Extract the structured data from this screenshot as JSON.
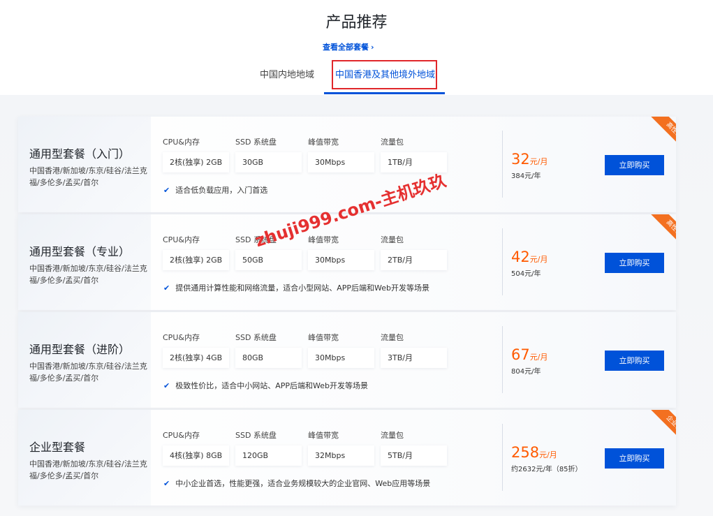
{
  "header": {
    "title": "产品推荐",
    "view_all": "查看全部套餐",
    "view_all_chevron": "›"
  },
  "tabs": [
    {
      "label": "中国内地地域",
      "active": false
    },
    {
      "label": "中国香港及其他境外地域",
      "active": true
    }
  ],
  "spec_labels": [
    "CPU&内存",
    "SSD 系统盘",
    "峰值带宽",
    "流量包"
  ],
  "buy_label": "立即购买",
  "accent_color": "#0052d9",
  "price_color": "#ff5a00",
  "ribbon_color": "#f37020",
  "plans": [
    {
      "name": "通用型套餐（入门）",
      "regions": "中国香港/新加坡/东京/硅谷/法兰克福/多伦多/孟买/首尔",
      "specs": [
        "2核(独享) 2GB",
        "30GB",
        "30Mbps",
        "1TB/月"
      ],
      "feature": "适合低负载应用，入门首选",
      "price": "32",
      "price_unit": "元/月",
      "price_sub": "384元/年",
      "ribbon": "高性价比"
    },
    {
      "name": "通用型套餐（专业）",
      "regions": "中国香港/新加坡/东京/硅谷/法兰克福/多伦多/孟买/首尔",
      "specs": [
        "2核(独享) 2GB",
        "50GB",
        "30Mbps",
        "2TB/月"
      ],
      "feature": "提供通用计算性能和网络流量，适合小型网站、APP后端和Web开发等场景",
      "price": "42",
      "price_unit": "元/月",
      "price_sub": "504元/年",
      "ribbon": "高性价比"
    },
    {
      "name": "通用型套餐（进阶）",
      "regions": "中国香港/新加坡/东京/硅谷/法兰克福/多伦多/孟买/首尔",
      "specs": [
        "2核(独享) 4GB",
        "80GB",
        "30Mbps",
        "3TB/月"
      ],
      "feature": "极致性价比，适合中小网站、APP后端和Web开发等场景",
      "price": "67",
      "price_unit": "元/月",
      "price_sub": "804元/年",
      "ribbon": ""
    },
    {
      "name": "企业型套餐",
      "regions": "中国香港/新加坡/东京/硅谷/法兰克福/多伦多/孟买/首尔",
      "specs": [
        "4核(独享) 8GB",
        "120GB",
        "32Mbps",
        "5TB/月"
      ],
      "feature": "中小企业首选，性能更强，适合业务规模较大的企业官网、Web应用等场景",
      "price": "258",
      "price_unit": "元/月",
      "price_sub": "约2632元/年（85折）",
      "ribbon": "企业首选"
    }
  ],
  "watermark": "zhuji999.com-主机玖玖"
}
